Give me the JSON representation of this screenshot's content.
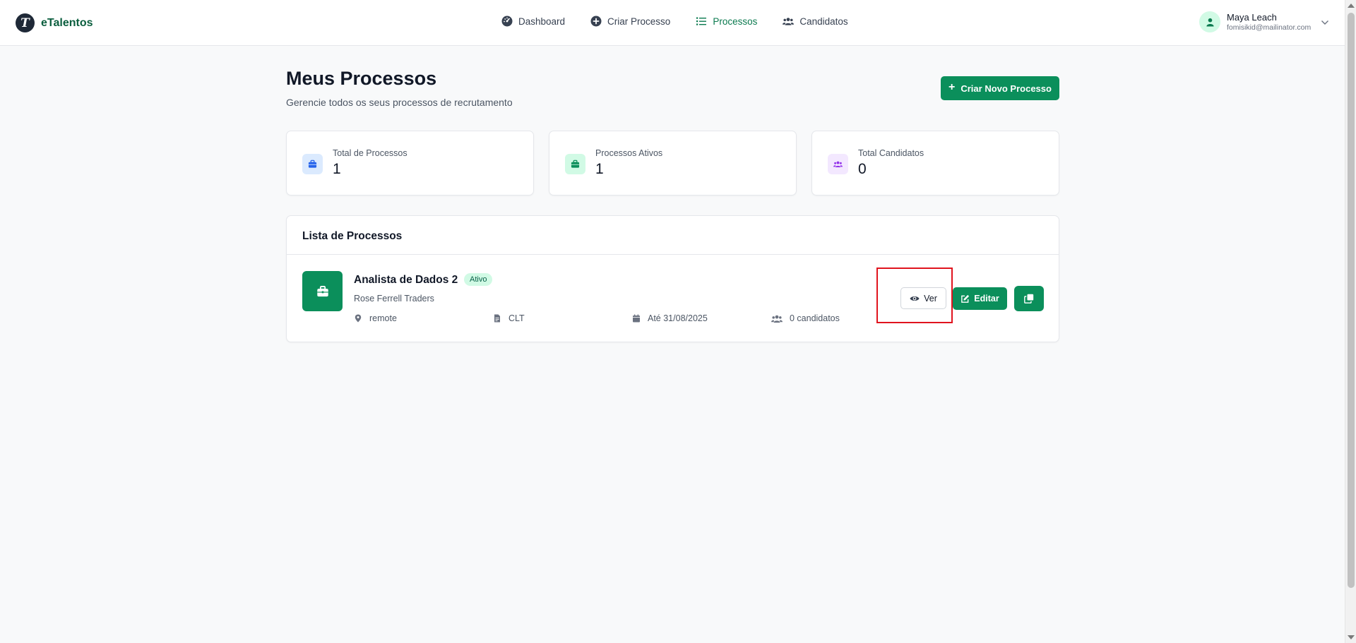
{
  "brand": {
    "logo_letter": "T",
    "name": "eTalentos"
  },
  "nav": [
    {
      "label": "Dashboard",
      "icon": "dashboard-gauge-icon",
      "active": false
    },
    {
      "label": "Criar Processo",
      "icon": "plus-circle-icon",
      "active": false
    },
    {
      "label": "Processos",
      "icon": "list-icon",
      "active": true
    },
    {
      "label": "Candidatos",
      "icon": "users-icon",
      "active": false
    }
  ],
  "user": {
    "name": "Maya Leach",
    "email": "fomisikid@mailinator.com",
    "icon": "user-icon"
  },
  "page": {
    "title": "Meus Processos",
    "subtitle": "Gerencie todos os seus processos de recrutamento",
    "new_button_label": "Criar Novo Processo"
  },
  "stats": [
    {
      "label": "Total de Processos",
      "value": "1",
      "icon": "briefcase-icon",
      "color": "#2563eb",
      "bg": "#dbeafe"
    },
    {
      "label": "Processos Ativos",
      "value": "1",
      "icon": "briefcase-icon",
      "color": "#0b8f5b",
      "bg": "#d1fae5"
    },
    {
      "label": "Total Candidatos",
      "value": "0",
      "icon": "users-icon",
      "color": "#9333ea",
      "bg": "#f3e8ff"
    }
  ],
  "list": {
    "header": "Lista de Processos",
    "items": [
      {
        "title": "Analista de Dados 2",
        "status": "Ativo",
        "company": "Rose Ferrell Traders",
        "location": "remote",
        "contract": "CLT",
        "deadline": "Até 31/08/2025",
        "candidates": "0 candidatos",
        "view_label": "Ver",
        "edit_label": "Editar"
      }
    ]
  },
  "colors": {
    "primary": "#0b8f5b",
    "highlight": "#e0141e"
  }
}
